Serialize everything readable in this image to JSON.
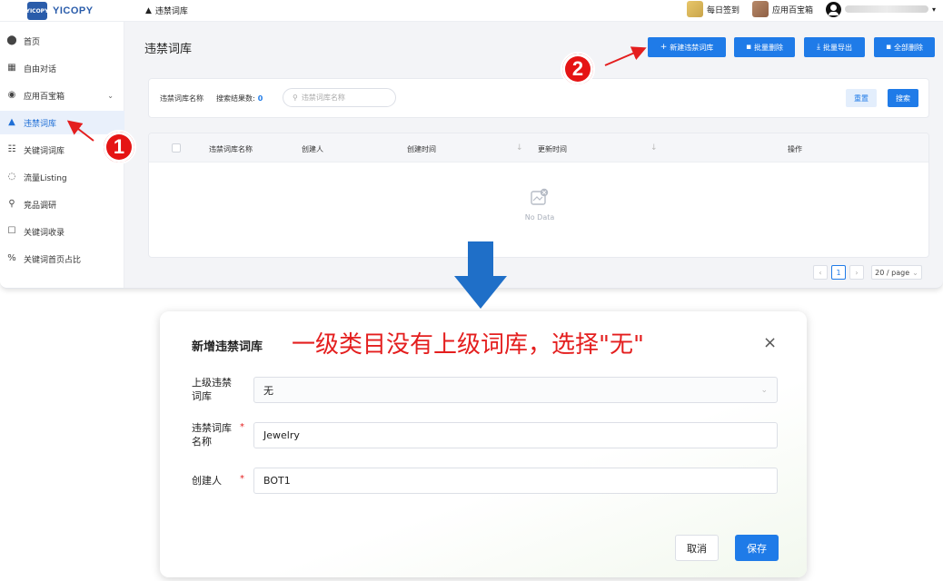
{
  "topbar": {
    "logo_mark": "YICOPY",
    "logo_text": "YICOPY",
    "breadcrumb": "违禁词库",
    "daily_checkin": "每日签到",
    "app_box": "应用百宝箱"
  },
  "sidebar": {
    "items": [
      {
        "label": "首页",
        "icon": "home-icon"
      },
      {
        "label": "自由对话",
        "icon": "chat-icon"
      },
      {
        "label": "应用百宝箱",
        "icon": "compass-icon"
      },
      {
        "label": "违禁词库",
        "icon": "warning-icon",
        "active": true
      },
      {
        "label": "关键词词库",
        "icon": "keyword-icon"
      },
      {
        "label": "流量Listing",
        "icon": "flow-icon"
      },
      {
        "label": "竞品调研",
        "icon": "research-icon"
      },
      {
        "label": "关键词收录",
        "icon": "record-icon"
      },
      {
        "label": "关键词首页占比",
        "icon": "percent-icon"
      }
    ]
  },
  "main": {
    "page_title": "违禁词库",
    "toolbar": {
      "new": "新建违禁词库",
      "batch_delete": "批量删除",
      "batch_export": "批量导出",
      "delete_all": "全部删除"
    },
    "search": {
      "name_label": "违禁词库名称",
      "count_label": "搜索结果数:",
      "count_value": "0",
      "placeholder": "违禁词库名称",
      "reset": "重置",
      "search": "搜索"
    },
    "table": {
      "columns": [
        "违禁词库名称",
        "创建人",
        "创建时间",
        "更新时间",
        "操作"
      ],
      "empty_text": "No Data"
    },
    "pagination": {
      "current_page": "1",
      "page_size": "20 / page"
    }
  },
  "annotations": {
    "step1": "1",
    "step2": "2",
    "accent_color": "#e41e1e"
  },
  "dialog": {
    "title": "新增违禁词库",
    "note": "一级类目没有上级词库，选择\"无\"",
    "fields": [
      {
        "label_line1": "上级违禁",
        "label_line2": "词库",
        "value": "无",
        "required": false
      },
      {
        "label_line1": "违禁词库",
        "label_line2": "名称",
        "value": "Jewelry",
        "required": true
      },
      {
        "label_line1": "创建人",
        "label_line2": "",
        "value": "BOT1",
        "required": true
      }
    ],
    "required_mark": "*",
    "cancel": "取消",
    "save": "保存"
  }
}
